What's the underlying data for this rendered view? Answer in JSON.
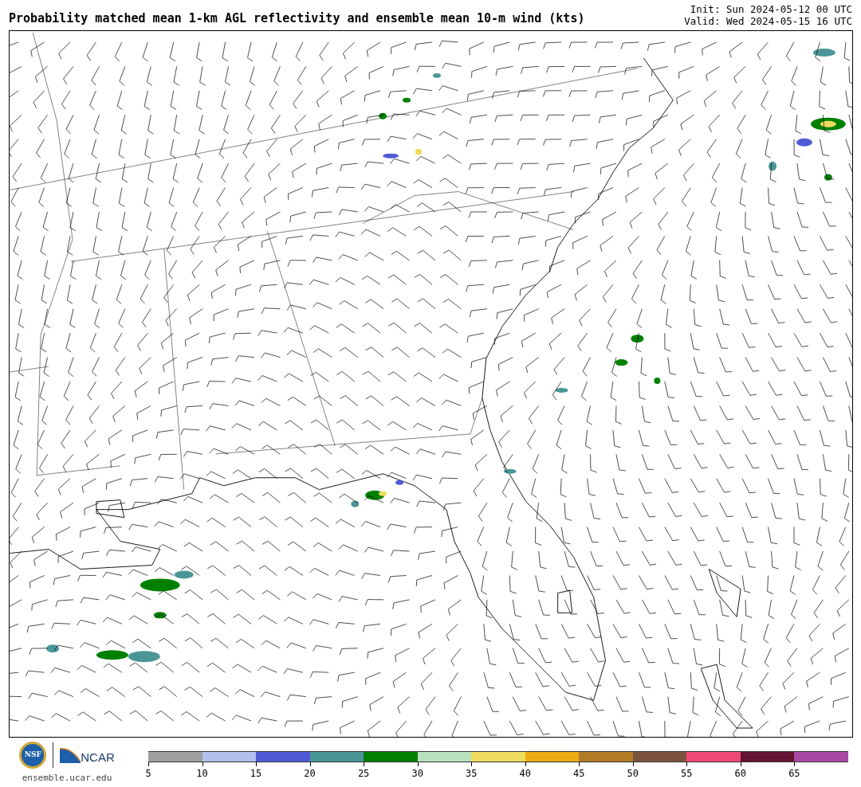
{
  "title": "Probability matched mean 1-km AGL reflectivity and ensemble mean 10-m wind (kts)",
  "init": "Init: Sun 2024-05-12 00 UTC",
  "valid": "Valid: Wed 2024-05-15 16 UTC",
  "logos": {
    "nsf": "NSF",
    "ncar": "NCAR"
  },
  "website": "ensemble.ucar.edu",
  "legend": [
    {
      "label": "5",
      "color": "#a0a0a0"
    },
    {
      "label": "10",
      "color": "#b4c0eb"
    },
    {
      "label": "15",
      "color": "#4e5bd5"
    },
    {
      "label": "20",
      "color": "#4a9697"
    },
    {
      "label": "25",
      "color": "#008000"
    },
    {
      "label": "30",
      "color": "#b9e1bd"
    },
    {
      "label": "35",
      "color": "#efdc5e"
    },
    {
      "label": "40",
      "color": "#edac13"
    },
    {
      "label": "45",
      "color": "#b47b27"
    },
    {
      "label": "50",
      "color": "#7d553f"
    },
    {
      "label": "55",
      "color": "#ef4a76"
    },
    {
      "label": "60",
      "color": "#651433"
    },
    {
      "label": "65",
      "color": "#ab4aa5"
    }
  ]
}
